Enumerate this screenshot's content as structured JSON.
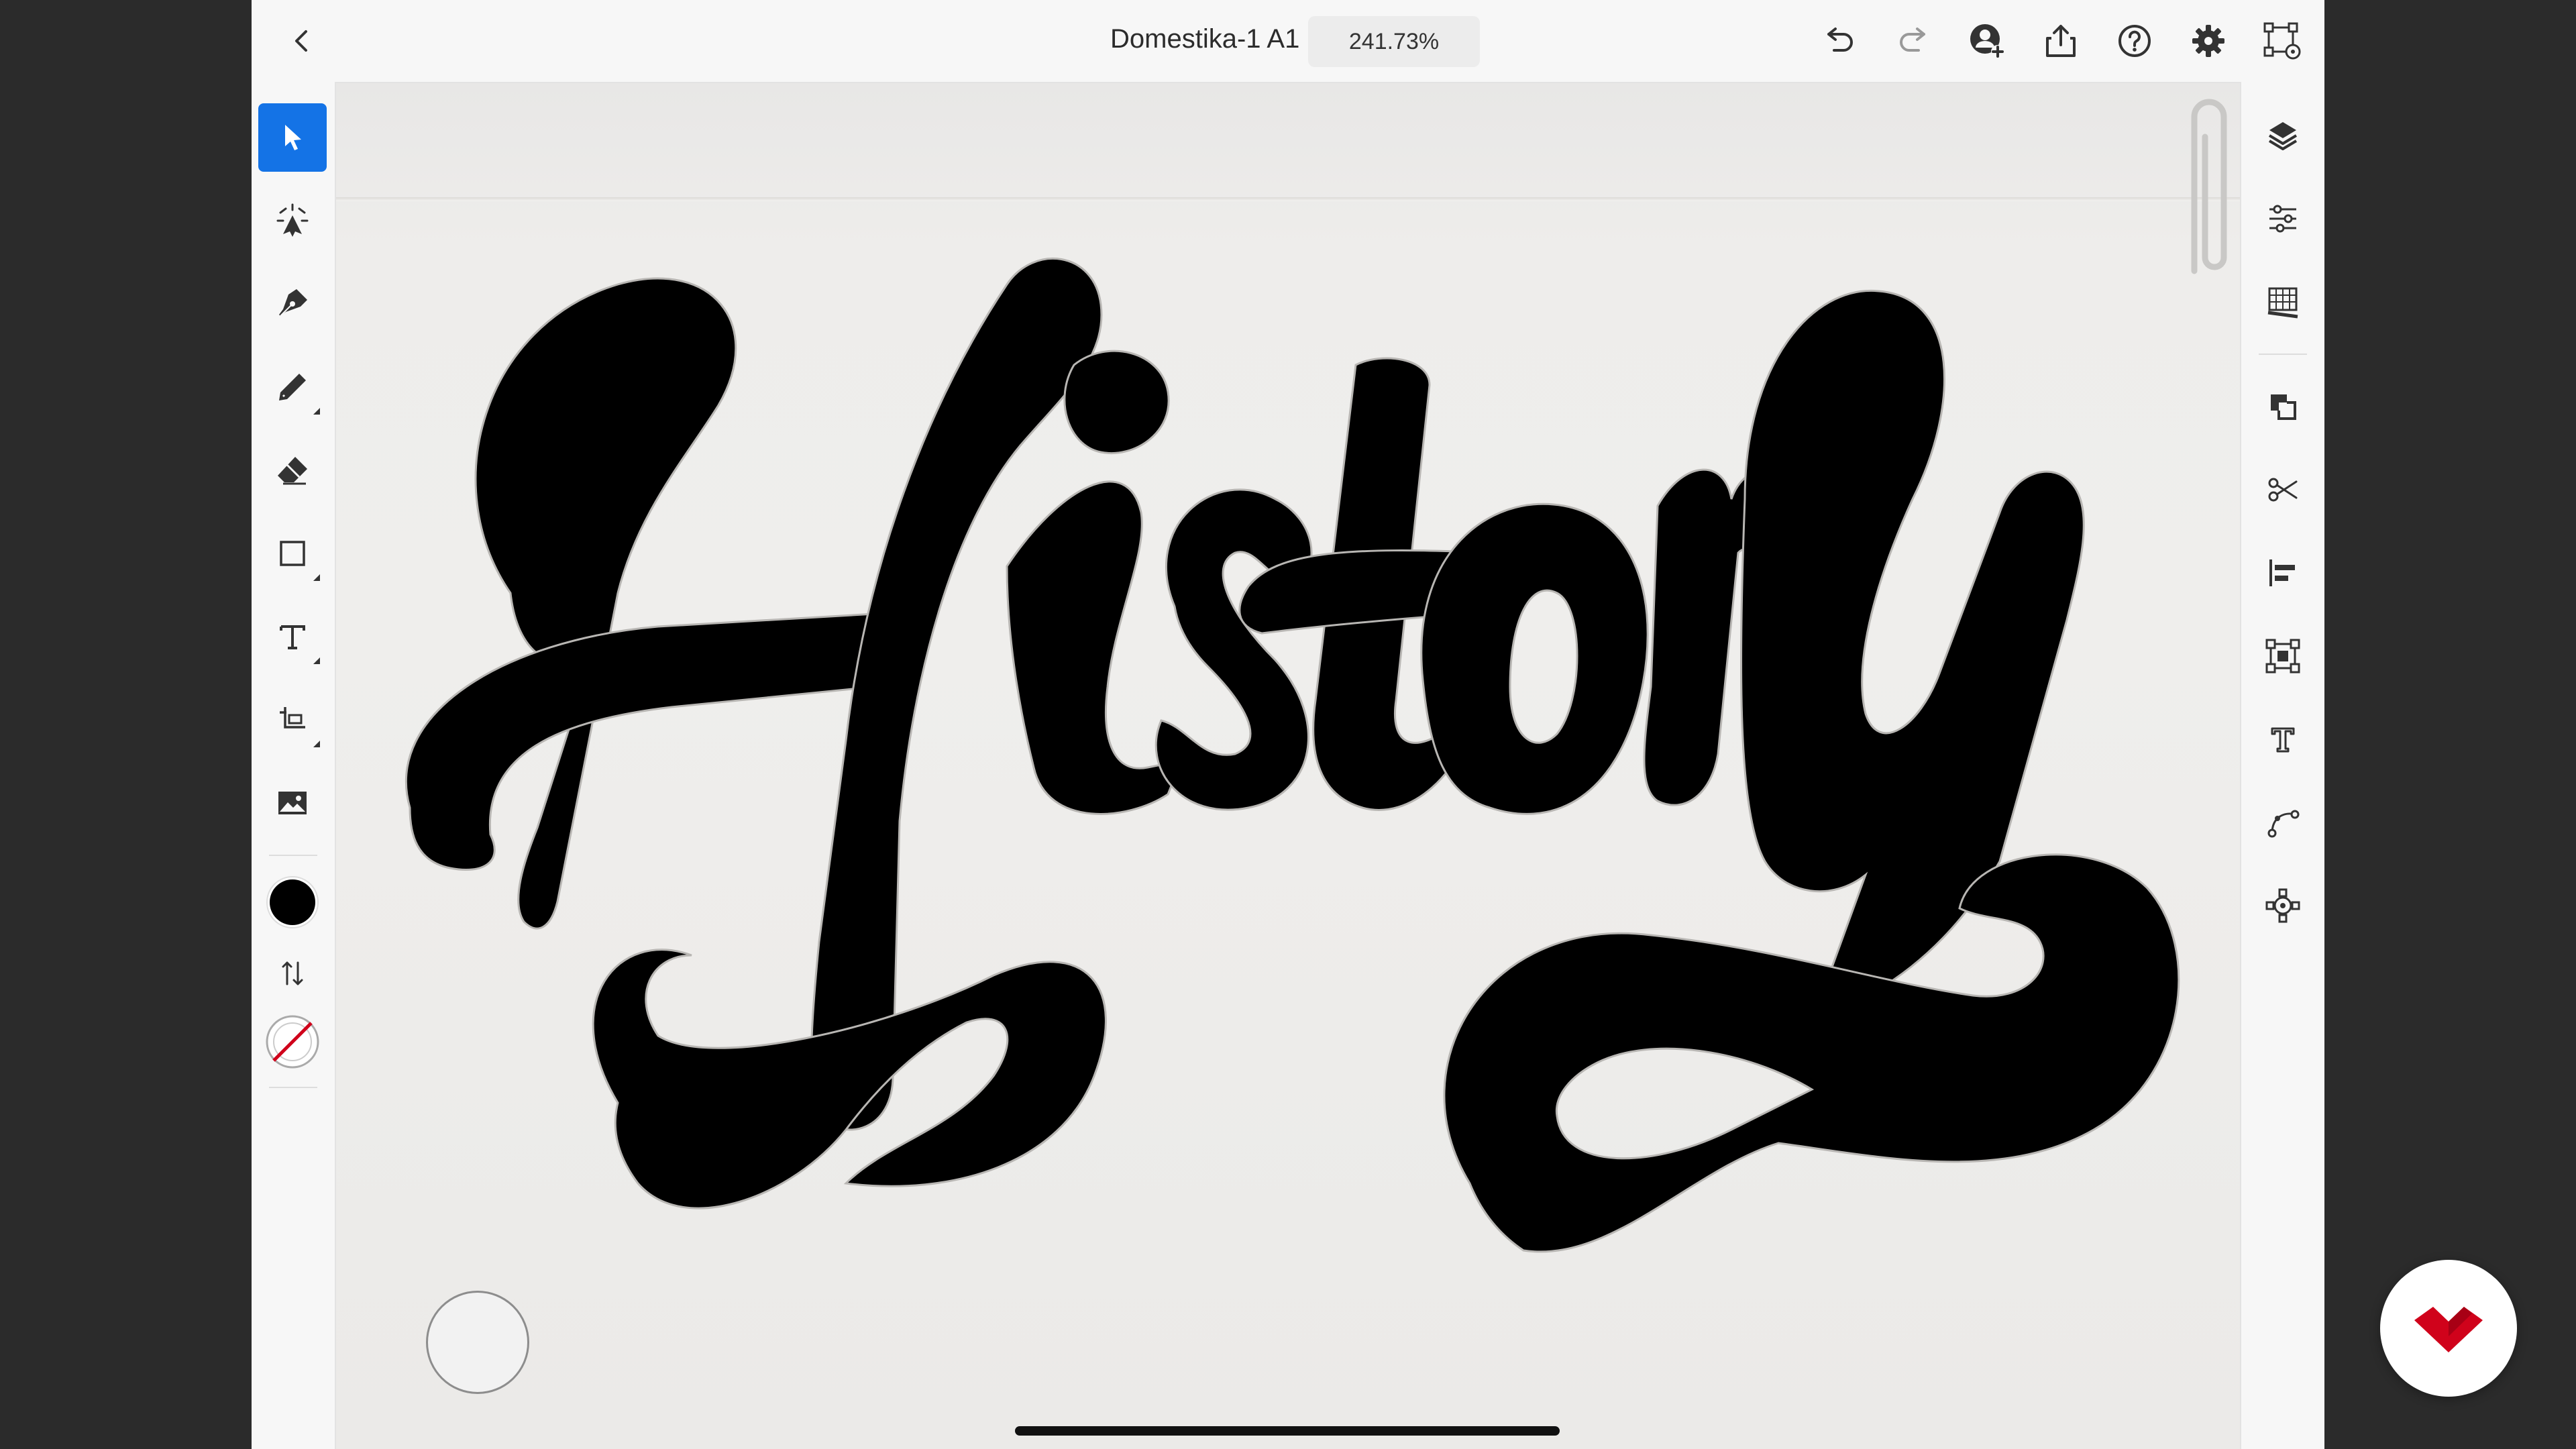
{
  "topbar": {
    "document_title": "Domestika-1 A1",
    "zoom_level": "241.73%"
  },
  "icons": {
    "back": "chevron-left-icon",
    "undo": "undo-icon",
    "redo": "redo-icon",
    "invite": "user-add-icon",
    "share": "share-icon",
    "help": "help-icon",
    "settings": "gear-icon",
    "transform": "transform-icon"
  },
  "left_tools": [
    {
      "name": "selection-tool",
      "active": true
    },
    {
      "name": "direct-selection-tool",
      "active": false
    },
    {
      "name": "pen-tool",
      "active": false
    },
    {
      "name": "pencil-tool",
      "active": false
    },
    {
      "name": "eraser-tool",
      "active": false
    },
    {
      "name": "shape-tool",
      "active": false
    },
    {
      "name": "type-tool",
      "active": false
    },
    {
      "name": "transform-tool",
      "active": false
    },
    {
      "name": "image-tool",
      "active": false
    }
  ],
  "fill_color": "#000000",
  "stroke_color": "none",
  "right_tools": [
    "layers-icon",
    "properties-icon",
    "grid-icon",
    "combine-icon",
    "scissors-icon",
    "align-icon",
    "repeat-icon",
    "type-options-icon",
    "path-icon",
    "gear-mesh-icon"
  ],
  "artwork": {
    "lettering": "History",
    "ink_color": "#000000",
    "paper_color": "#eeedeb"
  },
  "colors": {
    "accent": "#1473e6",
    "brand": "#d0021b"
  }
}
